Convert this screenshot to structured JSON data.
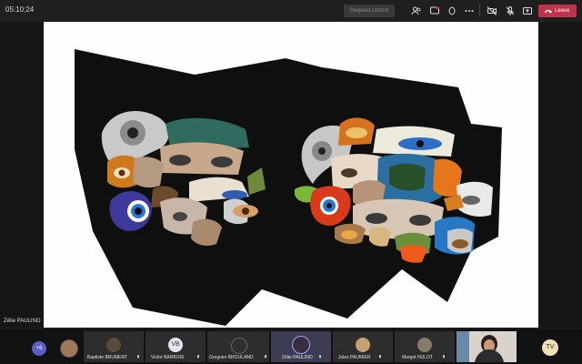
{
  "topbar": {
    "timer": "05:10:24",
    "request_control_label": "Request control",
    "leave_label": "Leave",
    "icons": [
      "people-icon",
      "chat-icon",
      "reactions-icon",
      "more-icon",
      "camera-off-icon",
      "mic-off-icon",
      "share-icon"
    ]
  },
  "stage": {
    "presenter_name": "Zélie PAULINO",
    "slide_description": "collage of eyes on black paper"
  },
  "participants": {
    "overflow_count": "+6",
    "tiles": [
      {
        "name": "Baptiste BRUMENT",
        "initials": ""
      },
      {
        "name": "Victor BARBOIS",
        "initials": "VB"
      },
      {
        "name": "Gregoire BROULAND",
        "initials": ""
      },
      {
        "name": "Zélie PAULINO",
        "initials": ""
      },
      {
        "name": "Jules PAUMIER",
        "initials": ""
      },
      {
        "name": "Margot HULOT",
        "initials": ""
      }
    ],
    "self_initials": "TV"
  },
  "colors": {
    "leave": "#c4314b",
    "accent": "#5b5fc7",
    "tv_avatar": "#f0dfb4",
    "vb_avatar": "#dfe6f2"
  }
}
